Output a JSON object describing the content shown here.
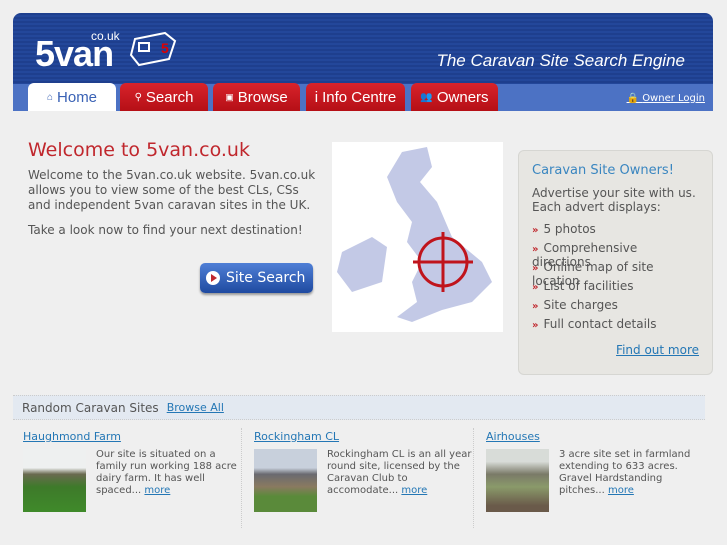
{
  "header": {
    "logo": "5van",
    "logo_suffix": "co.uk",
    "tagline": "The Caravan Site Search Engine",
    "owner_login": "Owner Login"
  },
  "nav": [
    {
      "label": "Home",
      "icon": "home-icon"
    },
    {
      "label": "Search",
      "icon": "search-icon"
    },
    {
      "label": "Browse",
      "icon": "browse-icon"
    },
    {
      "label": "Info Centre",
      "icon": "info-icon"
    },
    {
      "label": "Owners",
      "icon": "owners-icon"
    }
  ],
  "welcome": {
    "title": "Welcome to 5van.co.uk",
    "p1": "Welcome to the 5van.co.uk website. 5van.co.uk allows you to view some of the best CLs, CSs and independent 5van caravan sites in the UK.",
    "p2": "Take a look now to find your next destination!",
    "button": "Site Search"
  },
  "owners": {
    "title": "Caravan Site Owners!",
    "intro": "Advertise your site with us. Each advert displays:",
    "items": [
      "5 photos",
      "Comprehensive directions",
      "Online map of site location",
      "List of facilities",
      "Site charges",
      "Full contact details"
    ],
    "link": "Find out more"
  },
  "random": {
    "title": "Random Caravan Sites",
    "browse_all": "Browse All",
    "sites": [
      {
        "name": "Haughmond Farm",
        "desc": "Our site is situated on a family run working 188 acre dairy farm. It has well spaced...",
        "more": "more"
      },
      {
        "name": "Rockingham CL",
        "desc": "Rockingham CL is an all year round site, licensed by the Caravan Club to accomodate...",
        "more": "more"
      },
      {
        "name": "Airhouses",
        "desc": "3 acre site set in farmland extending to 633 acres. Gravel Hardstanding pitches...",
        "more": "more"
      }
    ]
  },
  "colors": {
    "red": "#c0272d",
    "blue": "#1e3f8e",
    "link": "#2477b5"
  }
}
